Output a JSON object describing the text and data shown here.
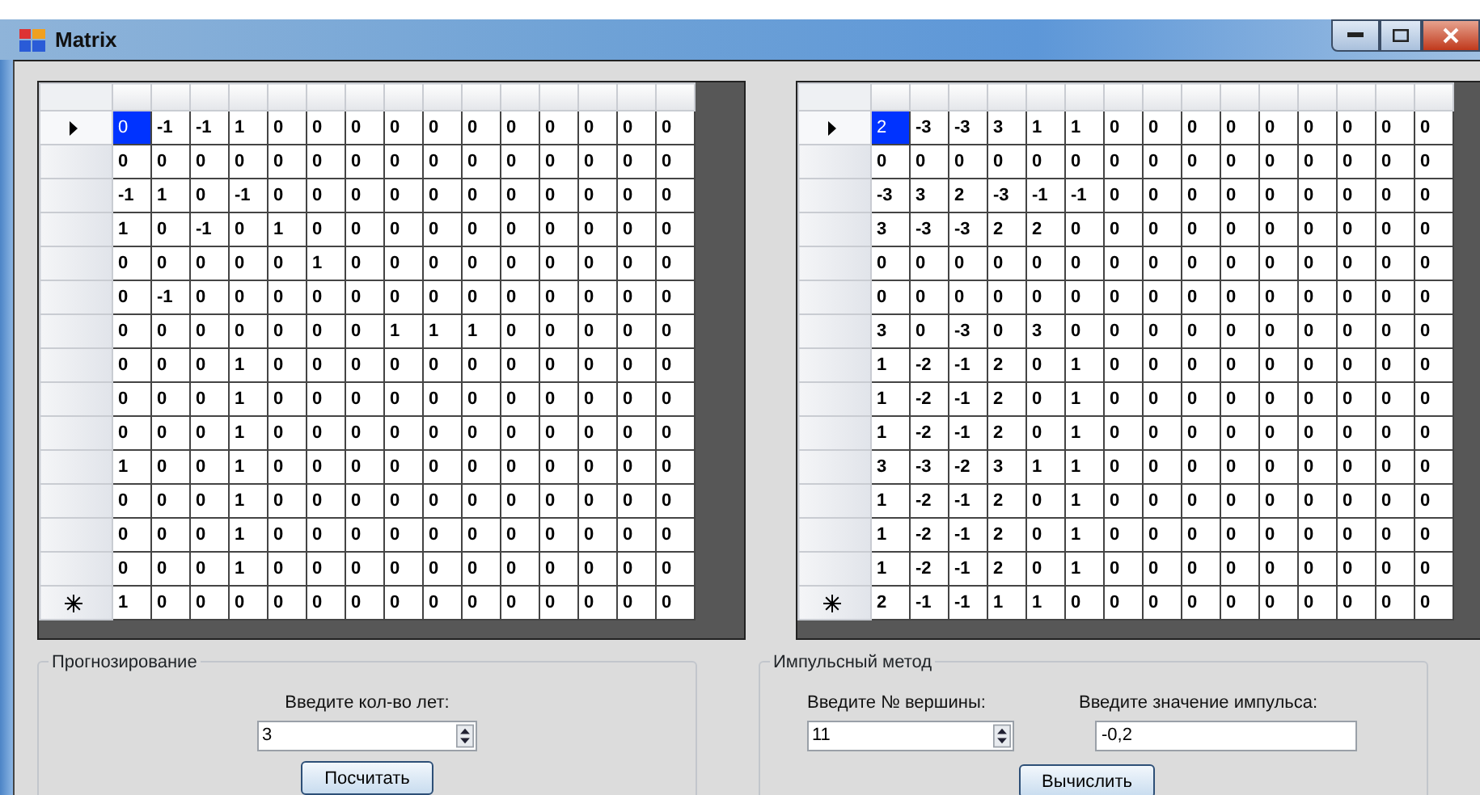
{
  "window": {
    "title": "Matrix"
  },
  "grids": [
    {
      "rows": [
        {
          "selected": true,
          "new_row": false,
          "cells": [
            "0",
            "-1",
            "-1",
            "1",
            "0",
            "0",
            "0",
            "0",
            "0",
            "0",
            "0",
            "0",
            "0",
            "0",
            "0"
          ]
        },
        {
          "selected": false,
          "new_row": false,
          "cells": [
            "0",
            "0",
            "0",
            "0",
            "0",
            "0",
            "0",
            "0",
            "0",
            "0",
            "0",
            "0",
            "0",
            "0",
            "0"
          ]
        },
        {
          "selected": false,
          "new_row": false,
          "cells": [
            "-1",
            "1",
            "0",
            "-1",
            "0",
            "0",
            "0",
            "0",
            "0",
            "0",
            "0",
            "0",
            "0",
            "0",
            "0"
          ]
        },
        {
          "selected": false,
          "new_row": false,
          "cells": [
            "1",
            "0",
            "-1",
            "0",
            "1",
            "0",
            "0",
            "0",
            "0",
            "0",
            "0",
            "0",
            "0",
            "0",
            "0"
          ]
        },
        {
          "selected": false,
          "new_row": false,
          "cells": [
            "0",
            "0",
            "0",
            "0",
            "0",
            "1",
            "0",
            "0",
            "0",
            "0",
            "0",
            "0",
            "0",
            "0",
            "0"
          ]
        },
        {
          "selected": false,
          "new_row": false,
          "cells": [
            "0",
            "-1",
            "0",
            "0",
            "0",
            "0",
            "0",
            "0",
            "0",
            "0",
            "0",
            "0",
            "0",
            "0",
            "0"
          ]
        },
        {
          "selected": false,
          "new_row": false,
          "cells": [
            "0",
            "0",
            "0",
            "0",
            "0",
            "0",
            "0",
            "1",
            "1",
            "1",
            "0",
            "0",
            "0",
            "0",
            "0"
          ]
        },
        {
          "selected": false,
          "new_row": false,
          "cells": [
            "0",
            "0",
            "0",
            "1",
            "0",
            "0",
            "0",
            "0",
            "0",
            "0",
            "0",
            "0",
            "0",
            "0",
            "0"
          ]
        },
        {
          "selected": false,
          "new_row": false,
          "cells": [
            "0",
            "0",
            "0",
            "1",
            "0",
            "0",
            "0",
            "0",
            "0",
            "0",
            "0",
            "0",
            "0",
            "0",
            "0"
          ]
        },
        {
          "selected": false,
          "new_row": false,
          "cells": [
            "0",
            "0",
            "0",
            "1",
            "0",
            "0",
            "0",
            "0",
            "0",
            "0",
            "0",
            "0",
            "0",
            "0",
            "0"
          ]
        },
        {
          "selected": false,
          "new_row": false,
          "cells": [
            "1",
            "0",
            "0",
            "1",
            "0",
            "0",
            "0",
            "0",
            "0",
            "0",
            "0",
            "0",
            "0",
            "0",
            "0"
          ]
        },
        {
          "selected": false,
          "new_row": false,
          "cells": [
            "0",
            "0",
            "0",
            "1",
            "0",
            "0",
            "0",
            "0",
            "0",
            "0",
            "0",
            "0",
            "0",
            "0",
            "0"
          ]
        },
        {
          "selected": false,
          "new_row": false,
          "cells": [
            "0",
            "0",
            "0",
            "1",
            "0",
            "0",
            "0",
            "0",
            "0",
            "0",
            "0",
            "0",
            "0",
            "0",
            "0"
          ]
        },
        {
          "selected": false,
          "new_row": false,
          "cells": [
            "0",
            "0",
            "0",
            "1",
            "0",
            "0",
            "0",
            "0",
            "0",
            "0",
            "0",
            "0",
            "0",
            "0",
            "0"
          ]
        },
        {
          "selected": false,
          "new_row": true,
          "cells": [
            "1",
            "0",
            "0",
            "0",
            "0",
            "0",
            "0",
            "0",
            "0",
            "0",
            "0",
            "0",
            "0",
            "0",
            "0"
          ]
        }
      ]
    },
    {
      "rows": [
        {
          "selected": true,
          "new_row": false,
          "cells": [
            "2",
            "-3",
            "-3",
            "3",
            "1",
            "1",
            "0",
            "0",
            "0",
            "0",
            "0",
            "0",
            "0",
            "0",
            "0"
          ]
        },
        {
          "selected": false,
          "new_row": false,
          "cells": [
            "0",
            "0",
            "0",
            "0",
            "0",
            "0",
            "0",
            "0",
            "0",
            "0",
            "0",
            "0",
            "0",
            "0",
            "0"
          ]
        },
        {
          "selected": false,
          "new_row": false,
          "cells": [
            "-3",
            "3",
            "2",
            "-3",
            "-1",
            "-1",
            "0",
            "0",
            "0",
            "0",
            "0",
            "0",
            "0",
            "0",
            "0"
          ]
        },
        {
          "selected": false,
          "new_row": false,
          "cells": [
            "3",
            "-3",
            "-3",
            "2",
            "2",
            "0",
            "0",
            "0",
            "0",
            "0",
            "0",
            "0",
            "0",
            "0",
            "0"
          ]
        },
        {
          "selected": false,
          "new_row": false,
          "cells": [
            "0",
            "0",
            "0",
            "0",
            "0",
            "0",
            "0",
            "0",
            "0",
            "0",
            "0",
            "0",
            "0",
            "0",
            "0"
          ]
        },
        {
          "selected": false,
          "new_row": false,
          "cells": [
            "0",
            "0",
            "0",
            "0",
            "0",
            "0",
            "0",
            "0",
            "0",
            "0",
            "0",
            "0",
            "0",
            "0",
            "0"
          ]
        },
        {
          "selected": false,
          "new_row": false,
          "cells": [
            "3",
            "0",
            "-3",
            "0",
            "3",
            "0",
            "0",
            "0",
            "0",
            "0",
            "0",
            "0",
            "0",
            "0",
            "0"
          ]
        },
        {
          "selected": false,
          "new_row": false,
          "cells": [
            "1",
            "-2",
            "-1",
            "2",
            "0",
            "1",
            "0",
            "0",
            "0",
            "0",
            "0",
            "0",
            "0",
            "0",
            "0"
          ]
        },
        {
          "selected": false,
          "new_row": false,
          "cells": [
            "1",
            "-2",
            "-1",
            "2",
            "0",
            "1",
            "0",
            "0",
            "0",
            "0",
            "0",
            "0",
            "0",
            "0",
            "0"
          ]
        },
        {
          "selected": false,
          "new_row": false,
          "cells": [
            "1",
            "-2",
            "-1",
            "2",
            "0",
            "1",
            "0",
            "0",
            "0",
            "0",
            "0",
            "0",
            "0",
            "0",
            "0"
          ]
        },
        {
          "selected": false,
          "new_row": false,
          "cells": [
            "3",
            "-3",
            "-2",
            "3",
            "1",
            "1",
            "0",
            "0",
            "0",
            "0",
            "0",
            "0",
            "0",
            "0",
            "0"
          ]
        },
        {
          "selected": false,
          "new_row": false,
          "cells": [
            "1",
            "-2",
            "-1",
            "2",
            "0",
            "1",
            "0",
            "0",
            "0",
            "0",
            "0",
            "0",
            "0",
            "0",
            "0"
          ]
        },
        {
          "selected": false,
          "new_row": false,
          "cells": [
            "1",
            "-2",
            "-1",
            "2",
            "0",
            "1",
            "0",
            "0",
            "0",
            "0",
            "0",
            "0",
            "0",
            "0",
            "0"
          ]
        },
        {
          "selected": false,
          "new_row": false,
          "cells": [
            "1",
            "-2",
            "-1",
            "2",
            "0",
            "1",
            "0",
            "0",
            "0",
            "0",
            "0",
            "0",
            "0",
            "0",
            "0"
          ]
        },
        {
          "selected": false,
          "new_row": true,
          "cells": [
            "2",
            "-1",
            "-1",
            "1",
            "1",
            "0",
            "0",
            "0",
            "0",
            "0",
            "0",
            "0",
            "0",
            "0",
            "0"
          ]
        }
      ]
    }
  ],
  "forecast": {
    "title": "Прогнозирование",
    "years_label": "Введите кол-во лет:",
    "years_value": "3",
    "button": "Посчитать"
  },
  "impulse": {
    "title": "Импульсный метод",
    "vertex_label": "Введите № вершины:",
    "vertex_value": "11",
    "impulse_label": "Введите значение импульса:",
    "impulse_value": "-0,2",
    "button": "Вычислить"
  }
}
